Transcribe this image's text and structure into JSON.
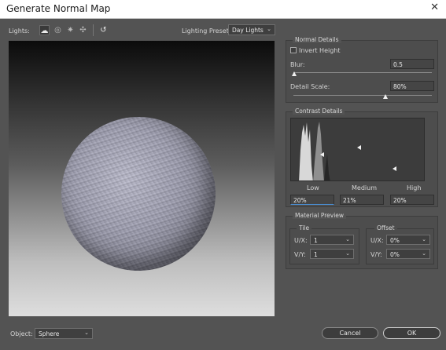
{
  "window": {
    "title": "Generate Normal Map",
    "close_glyph": "✕"
  },
  "toolbar": {
    "lights_label": "Lights:",
    "lighting_preset_label": "Lighting Preset:",
    "lighting_preset_value": "Day Lights",
    "icons": [
      "add-infinite-light-icon",
      "add-spot-light-icon",
      "add-point-light-icon",
      "add-image-light-icon",
      "reset-lights-icon"
    ]
  },
  "normal_details": {
    "title": "Normal Details",
    "invert_height_label": "Invert Height",
    "invert_height_checked": false,
    "blur_label": "Blur:",
    "blur_value": "0.5",
    "blur_fraction": 0.0,
    "detail_scale_label": "Detail Scale:",
    "detail_scale_value": "80%",
    "detail_scale_fraction": 0.8
  },
  "contrast_details": {
    "title": "Contrast Details",
    "low_label": "Low",
    "medium_label": "Medium",
    "high_label": "High",
    "low_value": "20%",
    "medium_value": "21%",
    "high_value": "20%"
  },
  "material_preview": {
    "title": "Material Preview",
    "tile": {
      "title": "Tile",
      "ux_label": "U/X:",
      "ux_value": "1",
      "vy_label": "V/Y:",
      "vy_value": "1"
    },
    "offset": {
      "title": "Offset",
      "ux_label": "U/X:",
      "ux_value": "0%",
      "vy_label": "V/Y:",
      "vy_value": "0%"
    }
  },
  "footer": {
    "object_label": "Object:",
    "object_value": "Sphere",
    "cancel_label": "Cancel",
    "ok_label": "OK"
  },
  "colors": {
    "dialog_bg": "#535353",
    "panel_bg": "#4d4d4d",
    "field_bg": "#454545",
    "title_bar": "#ffffff"
  }
}
